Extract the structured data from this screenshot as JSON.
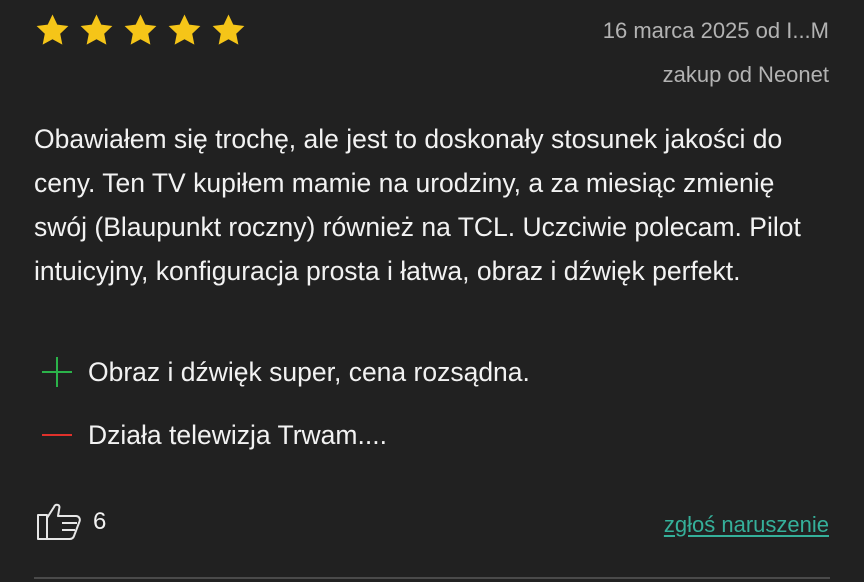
{
  "rating": {
    "stars": 5,
    "max": 5,
    "star_color": "#f5c518"
  },
  "meta": {
    "date_author": "16 marca 2025 od I...M",
    "purchase": "zakup od Neonet"
  },
  "review_text": "Obawiałem się trochę, ale jest to doskonały stosunek jakości do ceny. Ten TV kupiłem mamie na urodziny, a za miesiąc zmienię swój (Blaupunkt roczny) również na TCL. Uczciwie polecam. Pilot intuicyjny, konfiguracja prosta i łatwa, obraz i dźwięk perfekt.",
  "pros": {
    "text": "Obraz i dźwięk super, cena rozsądna.",
    "icon": "plus-icon",
    "color": "#2bb34a"
  },
  "cons": {
    "text": "Działa telewizja Trwam....",
    "icon": "minus-icon",
    "color": "#e0312b"
  },
  "actions": {
    "like_icon": "thumbs-up-icon",
    "like_count": "6",
    "report_label": "zgłoś naruszenie",
    "report_color": "#35b09a"
  }
}
